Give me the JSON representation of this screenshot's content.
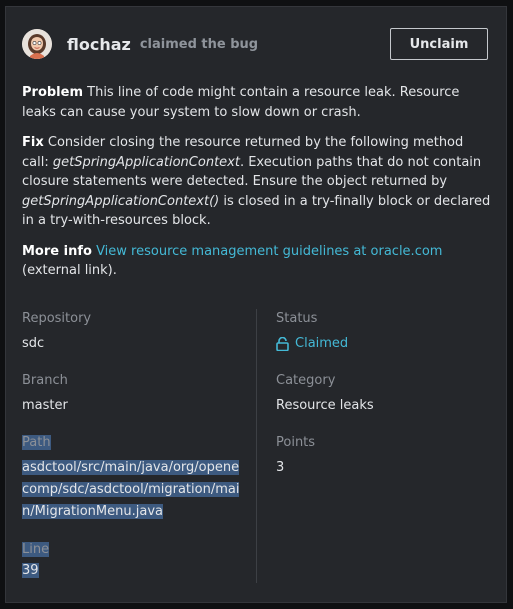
{
  "header": {
    "username": "flochaz",
    "action": "claimed the bug",
    "unclaim_label": "Unclaim"
  },
  "description": {
    "problem_label": "Problem",
    "problem_text": "This line of code might contain a resource leak. Resource leaks can cause your system to slow down or crash.",
    "fix_label": "Fix",
    "fix_text_1": "Consider closing the resource returned by the following method call: ",
    "fix_method_1": "getSpringApplicationContext",
    "fix_text_2": ". Execution paths that do not contain closure statements were detected. Ensure the object returned by ",
    "fix_method_2": "getSpringApplicationContext()",
    "fix_text_3": " is closed in a try-finally block or declared in a try-with-resources block.",
    "more_info_label": "More info",
    "more_info_link": "View resource management guidelines at oracle.com",
    "more_info_suffix": "(external link)."
  },
  "details": {
    "repository_label": "Repository",
    "repository": "sdc",
    "branch_label": "Branch",
    "branch": "master",
    "path_label": "Path",
    "path": "asdctool/src/main/java/org/openecomp/sdc/asdctool/migration/main/MigrationMenu.java",
    "line_label": "Line",
    "line": "39",
    "status_label": "Status",
    "status": "Claimed",
    "category_label": "Category",
    "category": "Resource leaks",
    "points_label": "Points",
    "points": "3"
  },
  "colors": {
    "accent": "#44b9d6",
    "card_bg": "#25272b",
    "selection": "#3d5a80"
  },
  "icons": {
    "avatar": "avatar-image",
    "status": "lock-open-icon"
  }
}
